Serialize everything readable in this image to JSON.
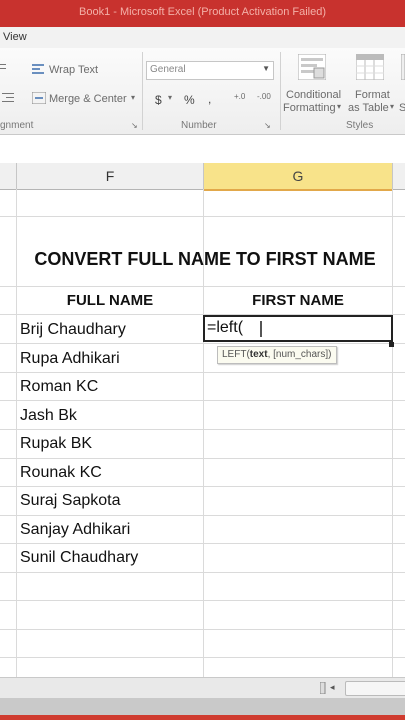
{
  "title_bar": {
    "text": "Book1 - Microsoft Excel (Product Activation Failed)"
  },
  "menu": {
    "view_tab": "View"
  },
  "ribbon": {
    "wrap_text": "Wrap Text",
    "merge_center": "Merge & Center",
    "number_format": "General",
    "currency": "$",
    "percent": "%",
    "comma": ",",
    "inc_decimal": "+.0",
    "dec_decimal": "-.00",
    "conditional_formatting": "Conditional",
    "conditional_formatting_2": "Formatting",
    "format_table": "Format",
    "format_table_2": "as Table",
    "cell_styles_initial": "S",
    "group_alignment": "gnment",
    "group_number": "Number",
    "group_styles": "Styles"
  },
  "columns": [
    {
      "letter": "F",
      "selected": false
    },
    {
      "letter": "G",
      "selected": true
    }
  ],
  "sheet": {
    "heading": "CONVERT FULL NAME TO FIRST NAME",
    "col_f_header": "FULL NAME",
    "col_g_header": "FIRST NAME",
    "names": [
      "Brij Chaudhary",
      "Rupa Adhikari",
      "Roman KC",
      "Jash Bk",
      "Rupak BK",
      "Rounak KC",
      "Suraj Sapkota",
      "Sanjay Adhikari",
      "Sunil Chaudhary"
    ],
    "active_formula": "=left(",
    "tooltip_fn": "LEFT(",
    "tooltip_arg1": "text",
    "tooltip_rest": ", [num_chars])"
  },
  "colors": {
    "title_bar": "#c8322e",
    "selected_col": "#f8e38a"
  }
}
